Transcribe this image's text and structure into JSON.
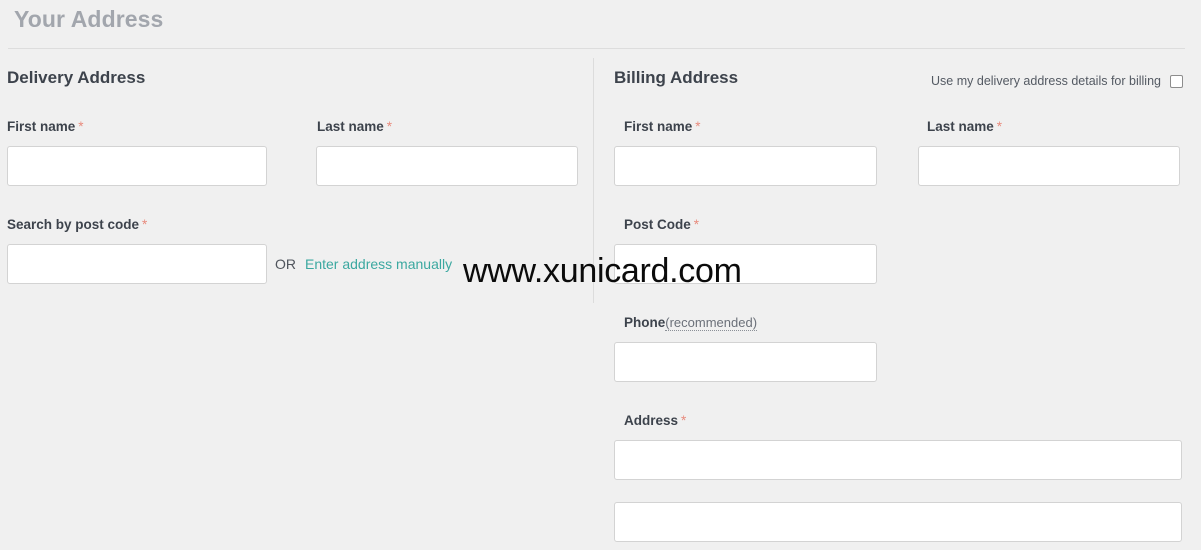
{
  "page": {
    "title": "Your Address"
  },
  "watermark": {
    "text": "www.xunicard.com"
  },
  "colors": {
    "background": "#f0f0f0",
    "title": "#a2a6ad",
    "heading": "#3d434c",
    "required_asterisk": "#e88b7d",
    "link_teal": "#3ba8a0",
    "input_border": "#d3d3d3",
    "divider": "#dddddd"
  },
  "delivery": {
    "heading": "Delivery Address",
    "fields": {
      "first_name": {
        "label": "First name",
        "required_marker": "*",
        "value": "",
        "placeholder": ""
      },
      "last_name": {
        "label": "Last name",
        "required_marker": "*",
        "value": "",
        "placeholder": ""
      },
      "post_code": {
        "label": "Search by post code",
        "required_marker": "*",
        "value": "",
        "placeholder": ""
      }
    },
    "or_text": "OR",
    "manual_link": "Enter address manually"
  },
  "billing": {
    "heading": "Billing Address",
    "copy_checkbox": {
      "label": "Use my delivery address details for billing",
      "checked": false
    },
    "fields": {
      "first_name": {
        "label": "First name",
        "required_marker": "*",
        "value": "",
        "placeholder": ""
      },
      "last_name": {
        "label": "Last name",
        "required_marker": "*",
        "value": "",
        "placeholder": ""
      },
      "post_code": {
        "label": "Post Code",
        "required_marker": "*",
        "value": "",
        "placeholder": ""
      },
      "phone": {
        "label": "Phone",
        "hint": "(recommended)",
        "value": "",
        "placeholder": ""
      },
      "address": {
        "label": "Address",
        "required_marker": "*",
        "line1_value": "",
        "line1_placeholder": "",
        "line2_value": "",
        "line2_placeholder": ""
      }
    }
  }
}
